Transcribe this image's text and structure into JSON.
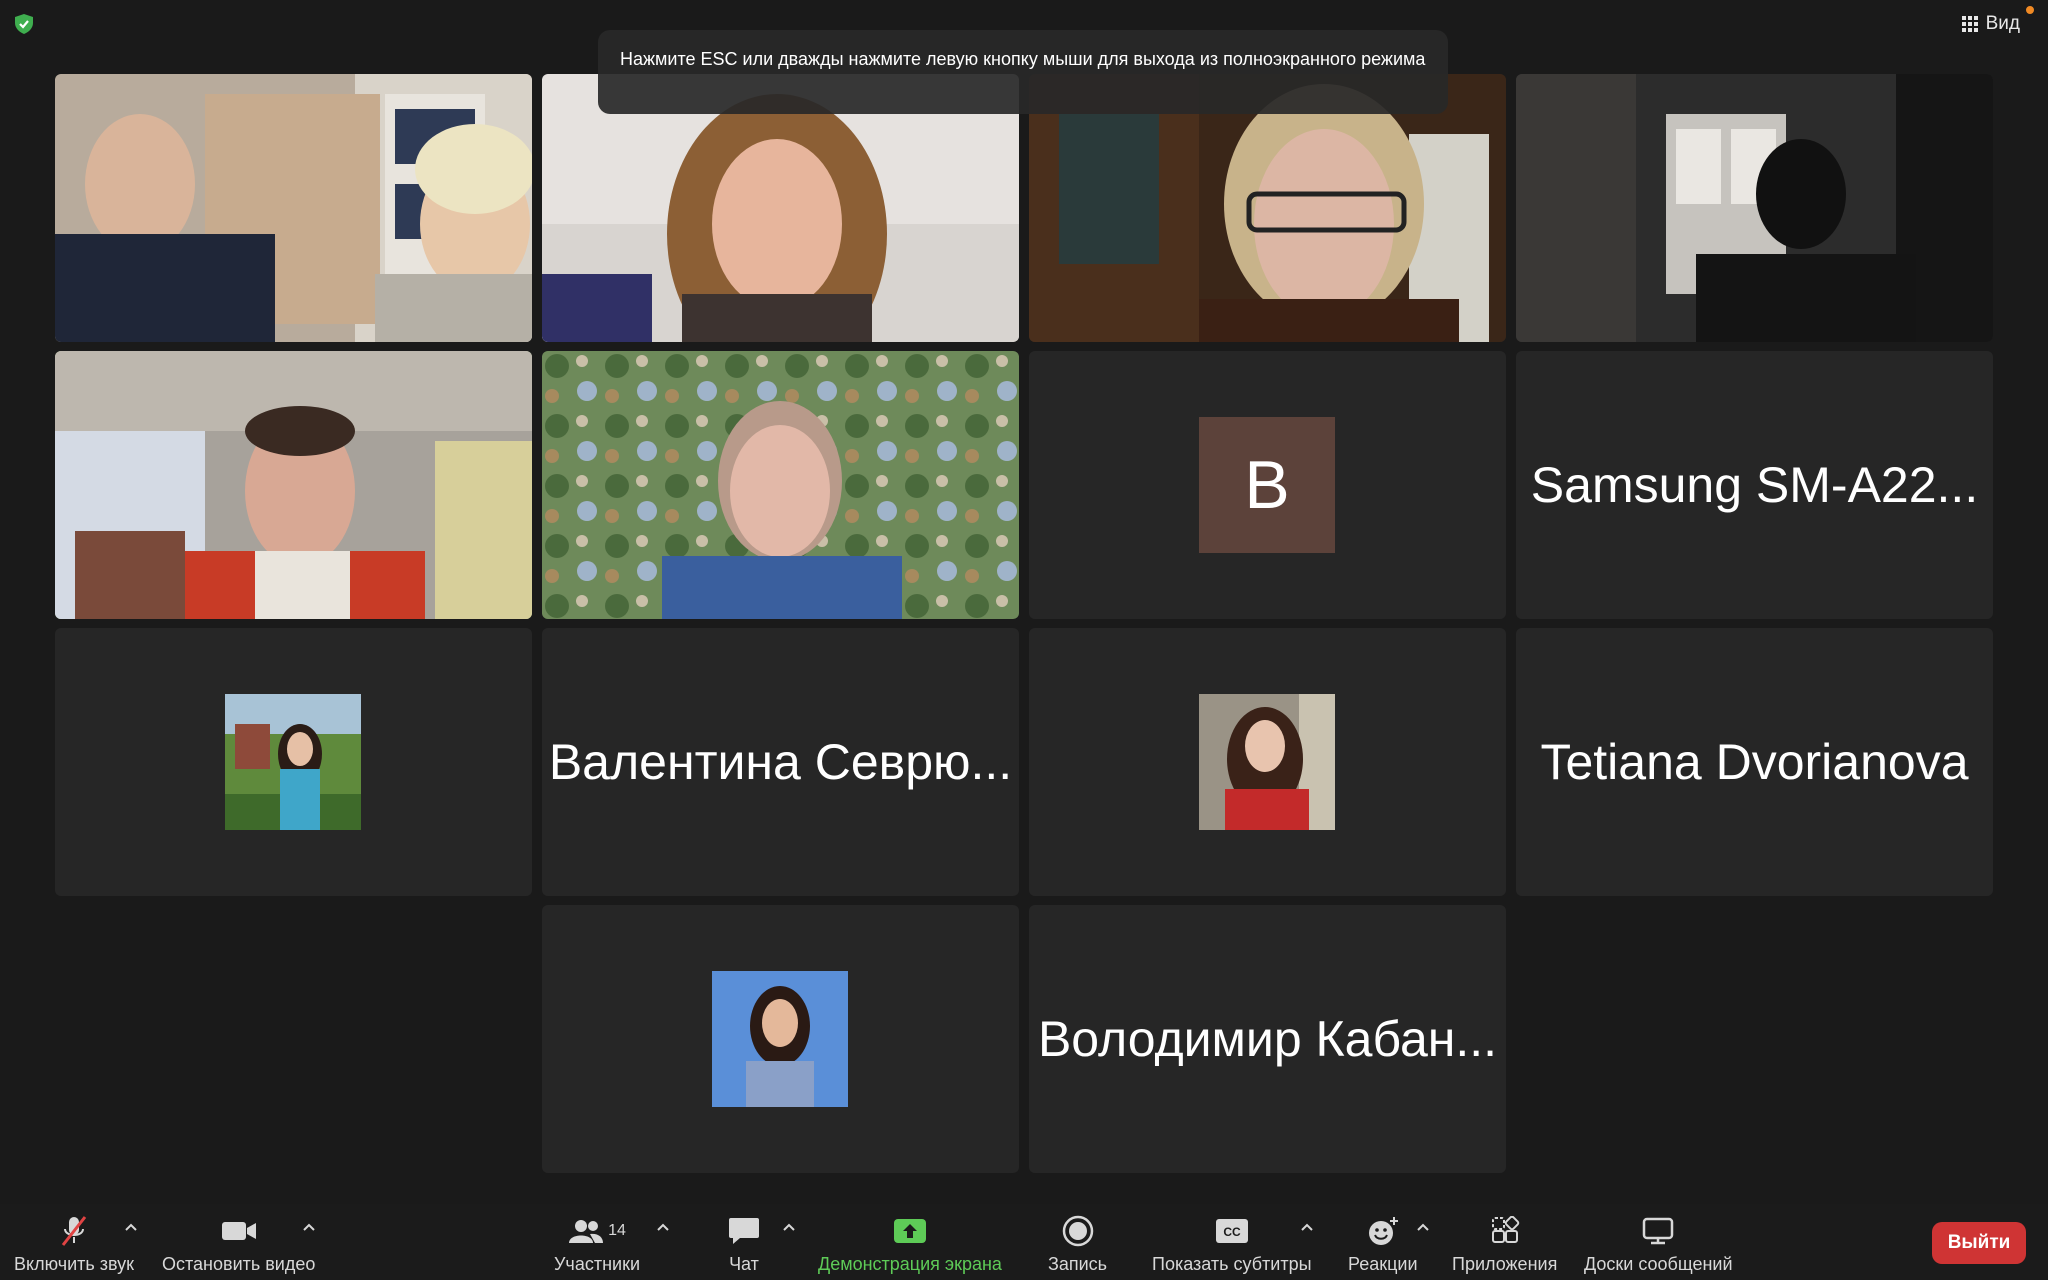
{
  "colors": {
    "background": "#1a1a1a",
    "tile": "#262626",
    "active_speaker": "#7cd35a",
    "share_green": "#5ecb57",
    "leave_red": "#cf3434",
    "avatar_v": "#5c423a"
  },
  "header": {
    "view_label": "Вид",
    "esc_message": "Нажмите ESC или дважды нажмите левую кнопку мыши для выхода из полноэкранного режима"
  },
  "tiles": {
    "t7_letter": "B",
    "t8_name": "Samsung SM-A22...",
    "t10_name": "Валентина Севрю...",
    "t12_name": "Tetiana Dvorianova",
    "t14_name": "Володимир Кабан..."
  },
  "toolbar": {
    "unmute": "Включить звук",
    "stop_video": "Остановить видео",
    "participants": "Участники",
    "participants_count": "14",
    "chat": "Чат",
    "share_screen": "Демонстрация экрана",
    "record": "Запись",
    "captions": "Показать субтитры",
    "captions_icon_text": "CC",
    "reactions": "Реакции",
    "apps": "Приложения",
    "whiteboards": "Доски сообщений",
    "leave": "Выйти"
  }
}
